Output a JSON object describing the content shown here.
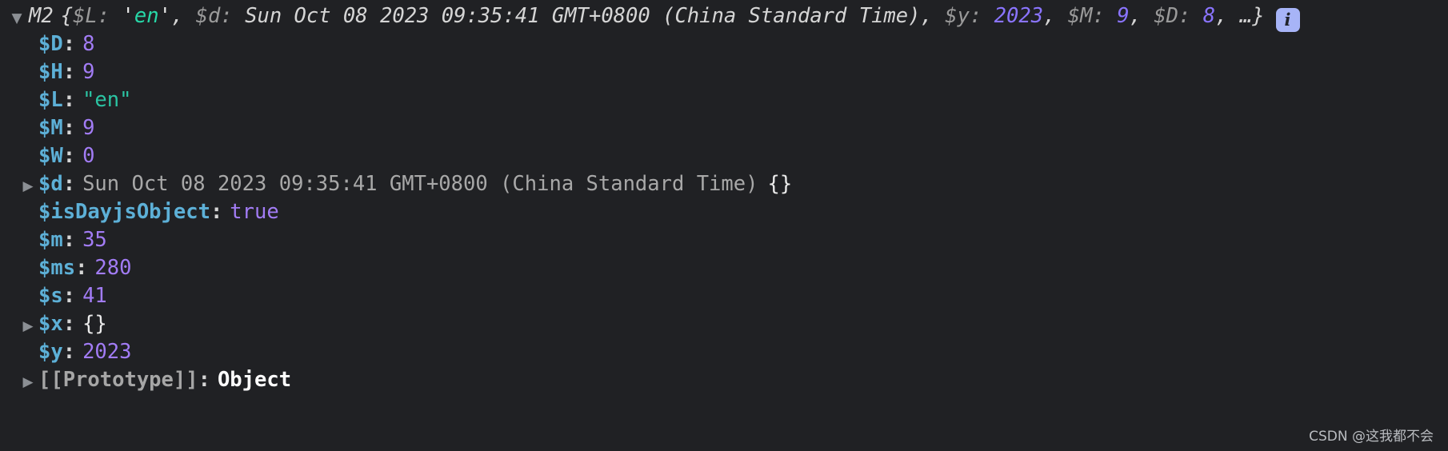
{
  "console": {
    "background_color": "#202124",
    "header": {
      "expanded": true,
      "twisty_icon": "triangle-down-icon",
      "constructor": "M2",
      "open_brace": "{",
      "close_brace": "}",
      "ellipsis": "…",
      "info_badge": {
        "icon": "info-icon",
        "label": "i",
        "background_color": "#a7b4f7",
        "text_color": "#20232b"
      },
      "preview": [
        {
          "key": "$L",
          "separator": ": ",
          "value": "en",
          "type": "string",
          "quote": "'",
          "trailing": ", "
        },
        {
          "key": "$d",
          "separator": ": ",
          "value": "Sun Oct 08 2023 09:35:41 GMT+0800 (China Standard Time)",
          "type": "date",
          "quote": "",
          "trailing": ", "
        },
        {
          "key": "$y",
          "separator": ": ",
          "value": "2023",
          "type": "number",
          "quote": "",
          "trailing": ", "
        },
        {
          "key": "$M",
          "separator": ": ",
          "value": "9",
          "type": "number",
          "quote": "",
          "trailing": ", "
        },
        {
          "key": "$D",
          "separator": ": ",
          "value": "8",
          "type": "number",
          "quote": "",
          "trailing": ", "
        }
      ]
    },
    "properties": [
      {
        "twisty": "none",
        "twisty_icon": "",
        "name": "$D",
        "separator": ":",
        "value": "8",
        "type": "number"
      },
      {
        "twisty": "none",
        "twisty_icon": "",
        "name": "$H",
        "separator": ":",
        "value": "9",
        "type": "number"
      },
      {
        "twisty": "none",
        "twisty_icon": "",
        "name": "$L",
        "separator": ":",
        "value": "\"en\"",
        "type": "string"
      },
      {
        "twisty": "none",
        "twisty_icon": "",
        "name": "$M",
        "separator": ":",
        "value": "9",
        "type": "number"
      },
      {
        "twisty": "none",
        "twisty_icon": "",
        "name": "$W",
        "separator": ":",
        "value": "0",
        "type": "number"
      },
      {
        "twisty": "closed",
        "twisty_icon": "triangle-right-icon",
        "name": "$d",
        "separator": ":",
        "value": "Sun Oct 08 2023 09:35:41 GMT+0800 (China Standard Time)",
        "type": "date",
        "suffix": "{}"
      },
      {
        "twisty": "none",
        "twisty_icon": "",
        "name": "$isDayjsObject",
        "separator": ":",
        "value": "true",
        "type": "boolean"
      },
      {
        "twisty": "none",
        "twisty_icon": "",
        "name": "$m",
        "separator": ":",
        "value": "35",
        "type": "number"
      },
      {
        "twisty": "none",
        "twisty_icon": "",
        "name": "$ms",
        "separator": ":",
        "value": "280",
        "type": "number"
      },
      {
        "twisty": "none",
        "twisty_icon": "",
        "name": "$s",
        "separator": ":",
        "value": "41",
        "type": "number"
      },
      {
        "twisty": "closed",
        "twisty_icon": "triangle-right-icon",
        "name": "$x",
        "separator": ":",
        "value": "{}",
        "type": "empty-object"
      },
      {
        "twisty": "none",
        "twisty_icon": "",
        "name": "$y",
        "separator": ":",
        "value": "2023",
        "type": "number"
      },
      {
        "twisty": "closed",
        "twisty_icon": "triangle-right-icon",
        "name": "[[Prototype]]",
        "separator": ":",
        "value": "Object",
        "type": "object",
        "internal": true
      }
    ]
  },
  "watermark": {
    "text": "CSDN @这我都不会"
  }
}
